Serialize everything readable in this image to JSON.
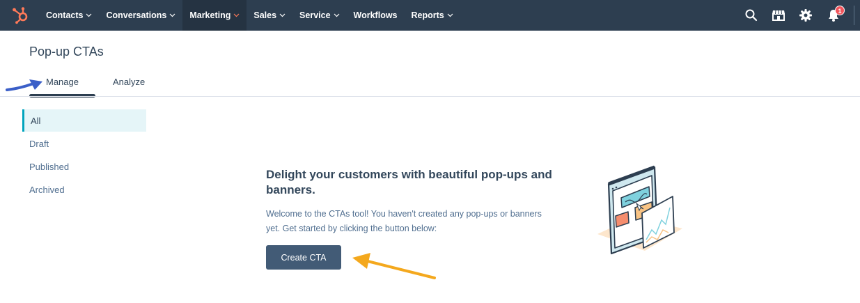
{
  "nav": {
    "logo_icon": "hubspot-sprocket-icon",
    "items": [
      {
        "label": "Contacts",
        "has_dropdown": true,
        "active": false
      },
      {
        "label": "Conversations",
        "has_dropdown": true,
        "active": false
      },
      {
        "label": "Marketing",
        "has_dropdown": true,
        "active": true
      },
      {
        "label": "Sales",
        "has_dropdown": true,
        "active": false
      },
      {
        "label": "Service",
        "has_dropdown": true,
        "active": false
      },
      {
        "label": "Workflows",
        "has_dropdown": false,
        "active": false
      },
      {
        "label": "Reports",
        "has_dropdown": true,
        "active": false
      }
    ],
    "right_icons": [
      "search-icon",
      "marketplace-icon",
      "settings-gear-icon",
      "notifications-bell-icon"
    ],
    "notification_count": "1",
    "colors": {
      "bar": "#2d3e50",
      "active": "#253342",
      "badge": "#f2545b",
      "logo": "#ff7a59"
    }
  },
  "page": {
    "title": "Pop-up CTAs",
    "tabs": [
      {
        "label": "Manage",
        "active": true
      },
      {
        "label": "Analyze",
        "active": false
      }
    ]
  },
  "sidebar": {
    "items": [
      {
        "label": "All",
        "active": true
      },
      {
        "label": "Draft",
        "active": false
      },
      {
        "label": "Published",
        "active": false
      },
      {
        "label": "Archived",
        "active": false
      }
    ],
    "accent": "#00a4bd"
  },
  "empty_state": {
    "heading": "Delight your customers with beautiful pop-ups and banners.",
    "text": "Welcome to the CTAs tool! You haven't created any pop-ups or banners yet. Get started by clicking the button below:",
    "button_label": "Create CTA",
    "illustration": "browser-popup-illustration"
  },
  "annotations": {
    "blue_arrow_color": "#3b5fc8",
    "orange_arrow_color": "#f4a81d"
  }
}
